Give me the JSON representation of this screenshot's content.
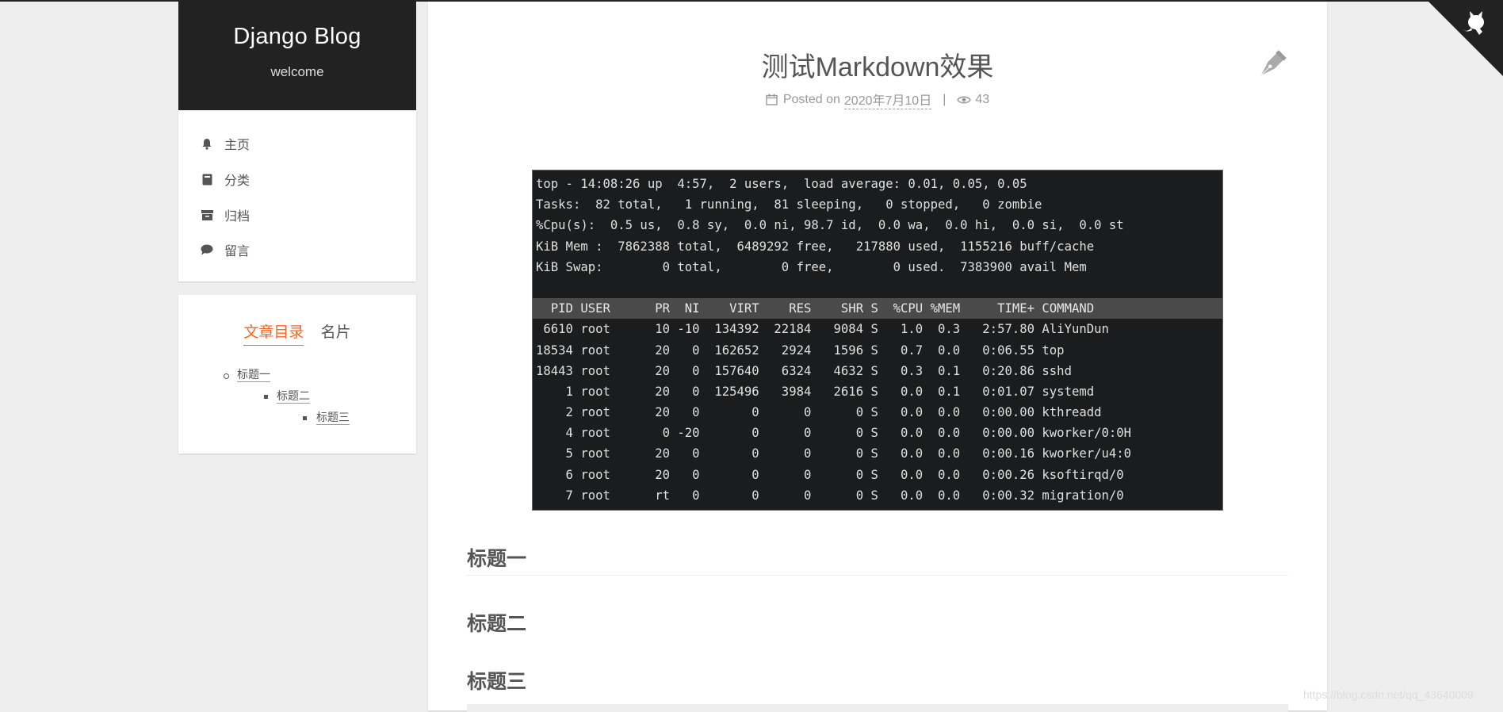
{
  "site": {
    "title": "Django Blog",
    "subtitle": "welcome"
  },
  "nav": {
    "items": [
      {
        "label": "主页",
        "icon": "bell-icon"
      },
      {
        "label": "分类",
        "icon": "book-icon"
      },
      {
        "label": "归档",
        "icon": "archive-icon"
      },
      {
        "label": "留言",
        "icon": "comment-icon"
      }
    ]
  },
  "sidebar_tabs": {
    "active": "文章目录",
    "other": "名片"
  },
  "toc": [
    "标题一",
    "标题二",
    "标题三"
  ],
  "post": {
    "title": "测试Markdown效果",
    "meta_prefix": "Posted on",
    "date": "2020年7月10日",
    "separator": "|",
    "views": "43"
  },
  "terminal_lines": [
    "top - 14:08:26 up  4:57,  2 users,  load average: 0.01, 0.05, 0.05",
    "Tasks:  82 total,   1 running,  81 sleeping,   0 stopped,   0 zombie",
    "%Cpu(s):  0.5 us,  0.8 sy,  0.0 ni, 98.7 id,  0.0 wa,  0.0 hi,  0.0 si,  0.0 st",
    "KiB Mem :  7862388 total,  6489292 free,   217880 used,  1155216 buff/cache",
    "KiB Swap:        0 total,        0 free,        0 used.  7383900 avail Mem",
    "",
    "  PID USER      PR  NI    VIRT    RES    SHR S  %CPU %MEM     TIME+ COMMAND",
    " 6610 root      10 -10  134392  22184   9084 S   1.0  0.3   2:57.80 AliYunDun",
    "18534 root      20   0  162652   2924   1596 S   0.7  0.0   0:06.55 top",
    "18443 root      20   0  157640   6324   4632 S   0.3  0.1   0:20.86 sshd",
    "    1 root      20   0  125496   3984   2616 S   0.0  0.1   0:01.07 systemd",
    "    2 root      20   0       0      0      0 S   0.0  0.0   0:00.00 kthreadd",
    "    4 root       0 -20       0      0      0 S   0.0  0.0   0:00.00 kworker/0:0H",
    "    5 root      20   0       0      0      0 S   0.0  0.0   0:00.16 kworker/u4:0",
    "    6 root      20   0       0      0      0 S   0.0  0.0   0:00.26 ksoftirqd/0",
    "    7 root      rt   0       0      0      0 S   0.0  0.0   0:00.32 migration/0"
  ],
  "headings": [
    "标题一",
    "标题二",
    "标题三"
  ],
  "watermark": "https://blog.csdn.net/qq_43640009",
  "colors": {
    "accent": "#fc6423",
    "header_bg": "#222222",
    "terminal_bg": "#1b1c1d"
  }
}
